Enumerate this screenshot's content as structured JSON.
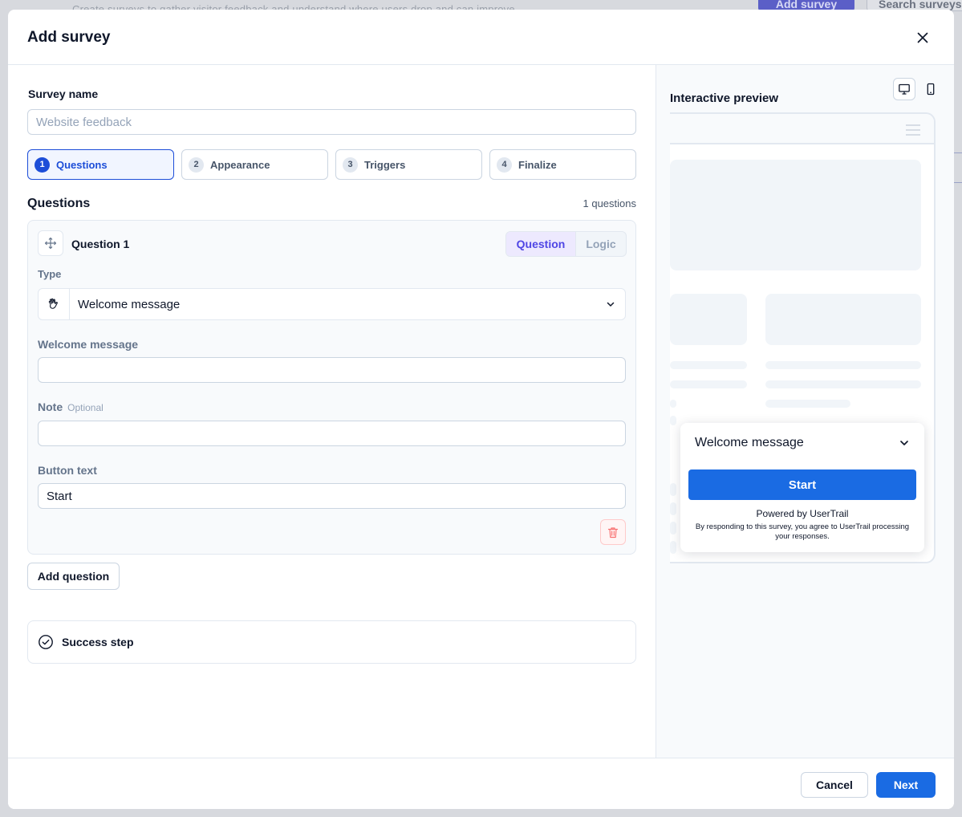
{
  "background": {
    "text": "Create surveys to gather visitor feedback and understand where users drop and can improve",
    "add_button": "Add survey",
    "search_placeholder": "Search surveys"
  },
  "modal": {
    "title": "Add survey",
    "survey_name": {
      "label": "Survey name",
      "placeholder": "Website feedback",
      "value": ""
    },
    "steps": [
      {
        "num": "1",
        "label": "Questions",
        "active": true
      },
      {
        "num": "2",
        "label": "Appearance",
        "active": false
      },
      {
        "num": "3",
        "label": "Triggers",
        "active": false
      },
      {
        "num": "4",
        "label": "Finalize",
        "active": false
      }
    ],
    "questions": {
      "title": "Questions",
      "count": "1 questions",
      "card": {
        "title": "Question 1",
        "tabs": {
          "question": "Question",
          "logic": "Logic"
        },
        "type_label": "Type",
        "type_value": "Welcome message",
        "welcome_label": "Welcome message",
        "welcome_value": "",
        "note_label": "Note",
        "note_optional": "Optional",
        "note_value": "",
        "button_label": "Button text",
        "button_value": "Start"
      },
      "add_question": "Add question",
      "success_step": "Success step"
    },
    "preview": {
      "title": "Interactive preview",
      "popup": {
        "title": "Welcome message",
        "start": "Start",
        "powered_by": "Powered by UserTrail",
        "disclaimer": "By responding to this survey, you agree to UserTrail processing your responses."
      }
    },
    "footer": {
      "cancel": "Cancel",
      "next": "Next"
    }
  },
  "colors": {
    "primary": "#1a6be3",
    "active_step": "#1d4ed8",
    "tab_active": "#4f46e5",
    "delete": "#f87171"
  }
}
